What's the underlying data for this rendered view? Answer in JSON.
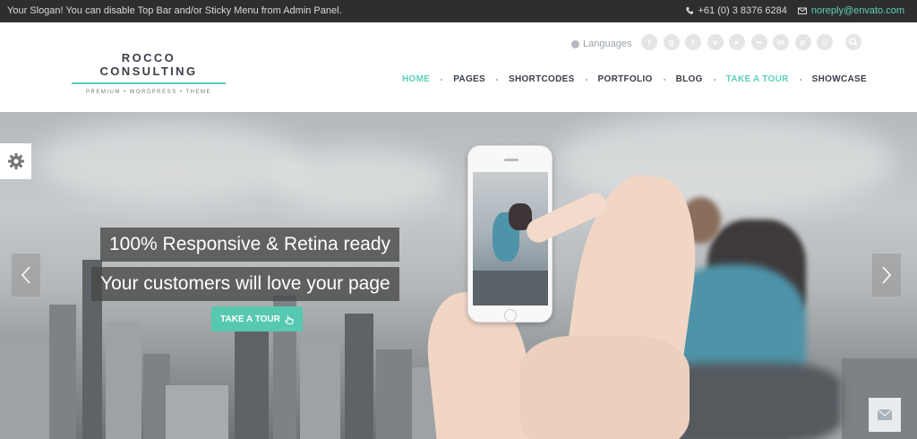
{
  "topbar": {
    "slogan": "Your Slogan! You can disable Top Bar and/or Sticky Menu from Admin Panel.",
    "phone": "+61 (0) 3 8376 6284",
    "email": "noreply@envato.com"
  },
  "logo": {
    "name": "ROCCO CONSULTING",
    "tagline": "PREMIUM • WORDPRESS • THEME"
  },
  "languages_label": "Languages",
  "social_icons": [
    "facebook",
    "google",
    "twitter",
    "vimeo",
    "youtube",
    "flickr",
    "linkedin",
    "pinterest",
    "dribbble"
  ],
  "nav": {
    "items": [
      {
        "label": "HOME",
        "active": true
      },
      {
        "label": "PAGES",
        "active": false
      },
      {
        "label": "SHORTCODES",
        "active": false
      },
      {
        "label": "PORTFOLIO",
        "active": false
      },
      {
        "label": "BLOG",
        "active": false
      },
      {
        "label": "TAKE A TOUR",
        "active": true
      },
      {
        "label": "SHOWCASE",
        "active": false
      }
    ]
  },
  "hero": {
    "caption_1": "100% Responsive & Retina ready",
    "caption_2": "Your customers will love your page",
    "cta_label": "TAKE A TOUR"
  },
  "colors": {
    "accent": "#56c9b0",
    "topbar_bg": "#2e2e2e",
    "nav_text": "#3a3f49"
  }
}
